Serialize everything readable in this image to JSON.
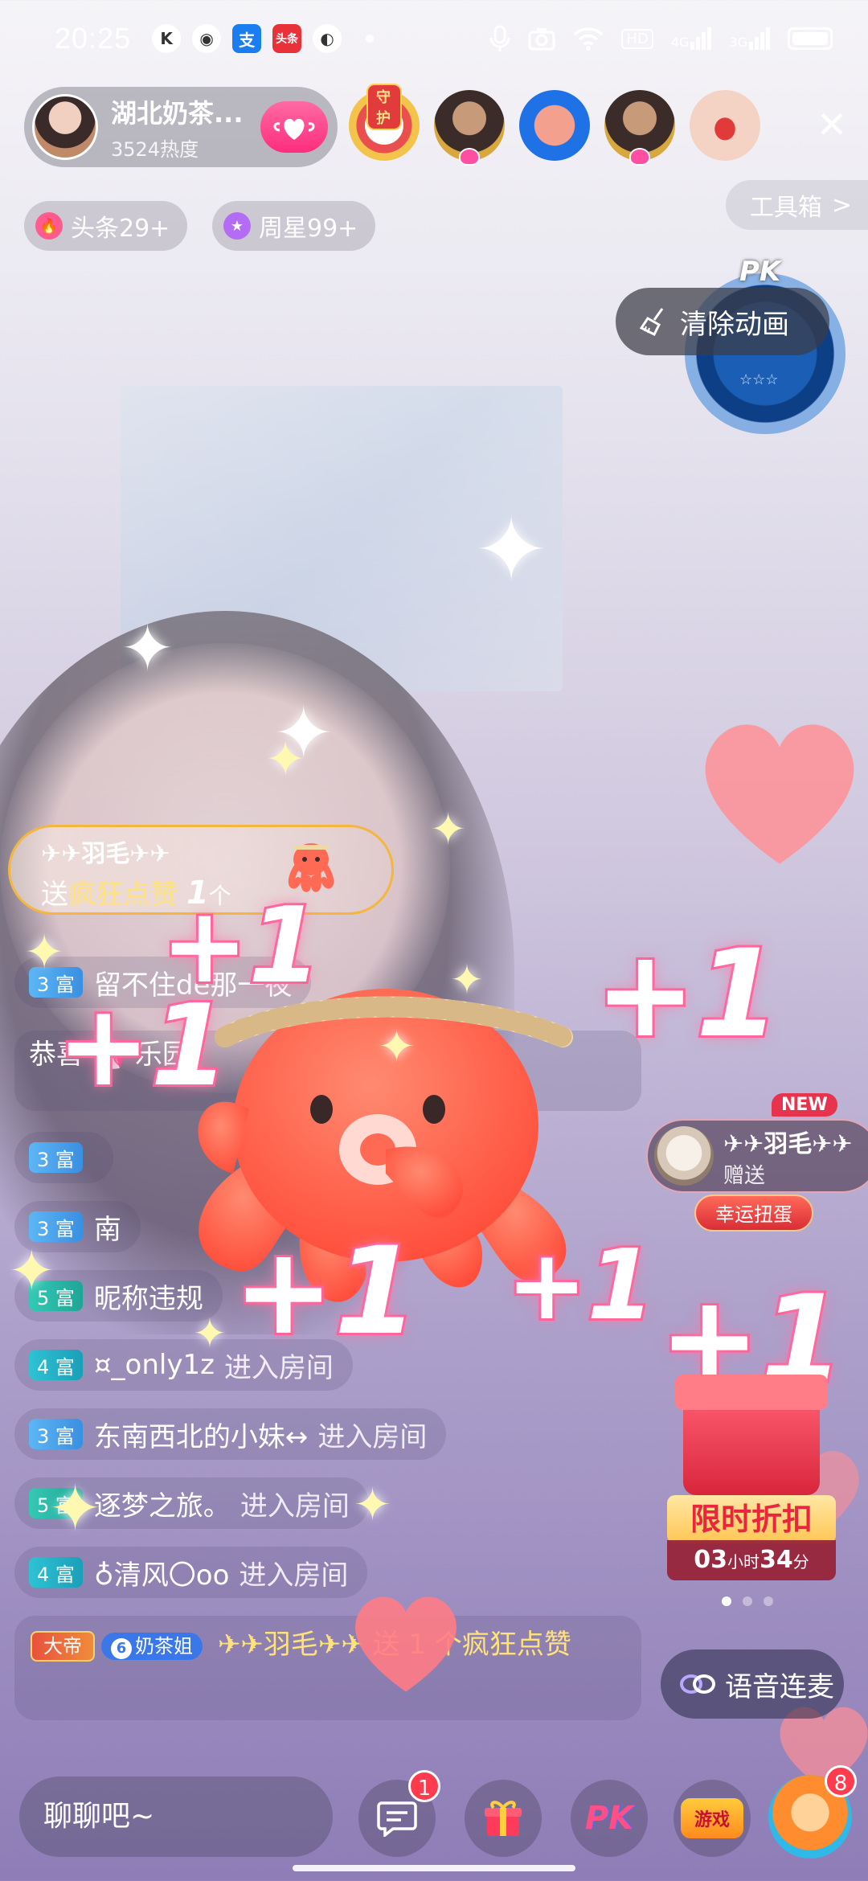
{
  "status_bar": {
    "time": "20:25",
    "network_label": "HD",
    "signal_4g": "4G",
    "signal_3g": "3G",
    "app_icons": [
      "kuaishou-k",
      "circle",
      "alipay",
      "toutiao",
      "browser"
    ],
    "toutiao_label": "头条"
  },
  "host": {
    "name": "湖北奶茶...",
    "heat": "3524热度"
  },
  "top_viewers": [
    {
      "type": "guard",
      "badge": "守护"
    },
    {
      "type": "man"
    },
    {
      "type": "blue"
    },
    {
      "type": "man"
    },
    {
      "type": "lips"
    }
  ],
  "tags": {
    "headline": "头条29+",
    "weekly_star": "周星99+"
  },
  "toolbox_label": "工具箱",
  "toolbox_arrow": ">",
  "pk_label": "PK",
  "pk_stars": "☆☆☆",
  "clear_animation_label": "清除动画",
  "gift_banner": {
    "user": "✈✈羽毛✈✈",
    "prefix": "送",
    "gift_name": "疯狂点赞",
    "count": "1",
    "unit": "个"
  },
  "chat": {
    "messages": [
      {
        "level": "3 富",
        "text": "留不住de那一夜",
        "enter": ""
      },
      {
        "level": "",
        "text": "恭喜 🦄 乐园",
        "enter": ""
      },
      {
        "level": "3 富",
        "text": "",
        "enter": ""
      },
      {
        "level": "3 富",
        "text": "南",
        "enter": ""
      },
      {
        "level": "5 富",
        "text": "昵称违规",
        "enter": ""
      },
      {
        "level": "4 富",
        "text": "¤_only1z",
        "enter": "进入房间"
      },
      {
        "level": "3 富",
        "text": "东南西北的小妹↔",
        "enter": "进入房间"
      },
      {
        "level": "5 富",
        "text": "逐梦之旅。",
        "enter": "进入房间"
      },
      {
        "level": "4 富",
        "text": "♁清风〇oo",
        "enter": "进入房间"
      }
    ],
    "highlight": {
      "badge": "大帝",
      "fan_level": "6",
      "fan_name": "奶茶姐",
      "text": "✈✈羽毛✈✈ 送 1 个疯狂点赞"
    }
  },
  "gifter_card": {
    "new_label": "NEW",
    "name": "✈✈羽毛✈✈",
    "action": "赠送",
    "lucky_label": "幸运扭蛋"
  },
  "sale": {
    "title": "限时折扣",
    "hours": "03",
    "hours_unit": "小时",
    "minutes": "34",
    "minutes_unit": "分"
  },
  "voice_link_label": "语音连麦",
  "effects": {
    "plus_one": "+1"
  },
  "bottom": {
    "chat_placeholder": "聊聊吧~",
    "message_badge": "1",
    "pk_label": "PK",
    "game_label": "游戏",
    "fox_badge": "8"
  },
  "colors": {
    "accent_pink": "#ff2d7e",
    "gold": "#f4b63e",
    "level_blue": "#3a8fe0"
  }
}
